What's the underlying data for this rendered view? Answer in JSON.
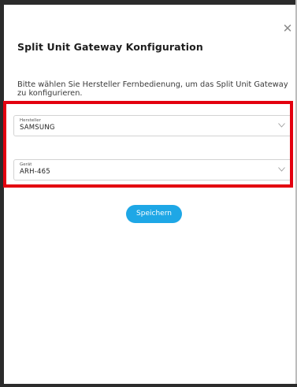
{
  "dialog": {
    "title": "Split Unit Gateway Konfiguration",
    "description": "Bitte wählen Sie Hersteller Fernbedienung, um das Split Unit Gateway zu konfigurieren.",
    "close_icon": "close-icon"
  },
  "fields": {
    "manufacturer": {
      "label": "Hersteller",
      "value": "SAMSUNG"
    },
    "device": {
      "label": "Gerät",
      "value": "ARH-465"
    }
  },
  "actions": {
    "save_label": "Speichern"
  },
  "colors": {
    "accent": "#1ea7e6",
    "highlight": "#e3000f"
  }
}
